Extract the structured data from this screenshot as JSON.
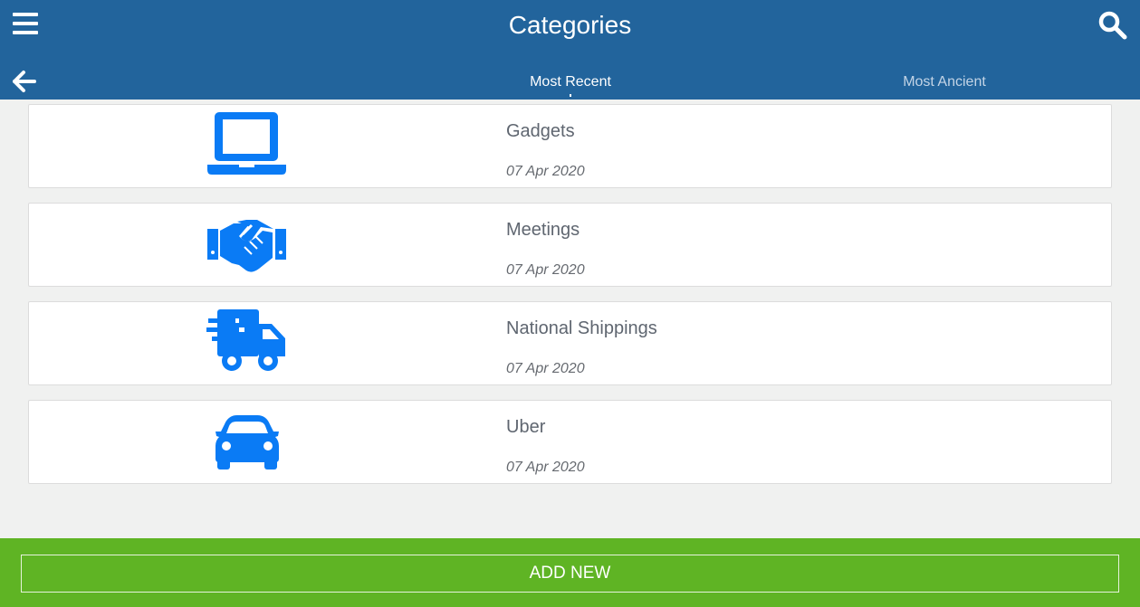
{
  "header": {
    "title": "Categories",
    "menu_icon": "hamburger-menu-icon",
    "search_icon": "search-icon",
    "back_icon": "arrow-left-icon",
    "background": "#22649c"
  },
  "tabs": [
    {
      "label": "Most Recent",
      "active": true
    },
    {
      "label": "Most Ancient",
      "active": false
    }
  ],
  "categories": [
    {
      "name": "Gadgets",
      "date": "07 Apr 2020",
      "icon": "laptop-icon"
    },
    {
      "name": "Meetings",
      "date": "07 Apr 2020",
      "icon": "handshake-icon"
    },
    {
      "name": "National Shippings",
      "date": "07 Apr 2020",
      "icon": "shipping-fast-icon"
    },
    {
      "name": "Uber",
      "date": "07 Apr 2020",
      "icon": "car-icon"
    }
  ],
  "footer": {
    "add_label": "ADD NEW",
    "background": "#5fb424"
  },
  "colors": {
    "icon_blue": "#0a7bf5",
    "page_background": "#f0f1f0"
  }
}
